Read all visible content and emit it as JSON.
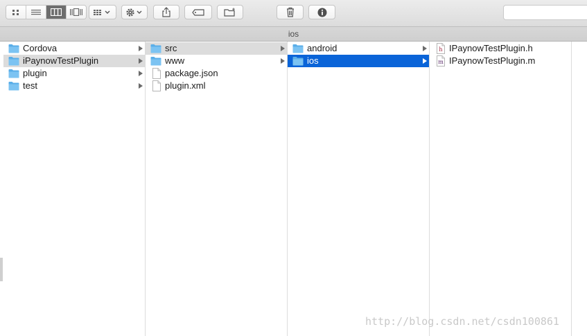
{
  "toolbar": {
    "view_modes": [
      "icon-view",
      "list-view",
      "column-view",
      "coverflow-view"
    ],
    "active_view": 2
  },
  "pathbar": {
    "title": "ios"
  },
  "columns": [
    {
      "items": [
        {
          "name": "Cordova",
          "type": "folder",
          "arrow": true,
          "selected": ""
        },
        {
          "name": "iPaynowTestPlugin",
          "type": "folder",
          "arrow": true,
          "selected": "gray"
        },
        {
          "name": "plugin",
          "type": "folder",
          "arrow": true,
          "selected": ""
        },
        {
          "name": "test",
          "type": "folder",
          "arrow": true,
          "selected": ""
        }
      ]
    },
    {
      "items": [
        {
          "name": "src",
          "type": "folder",
          "arrow": true,
          "selected": "gray"
        },
        {
          "name": "www",
          "type": "folder",
          "arrow": true,
          "selected": ""
        },
        {
          "name": "package.json",
          "type": "file",
          "arrow": false,
          "selected": ""
        },
        {
          "name": "plugin.xml",
          "type": "file",
          "arrow": false,
          "selected": ""
        }
      ]
    },
    {
      "items": [
        {
          "name": "android",
          "type": "folder",
          "arrow": true,
          "selected": ""
        },
        {
          "name": "ios",
          "type": "folder",
          "arrow": true,
          "selected": "blue"
        }
      ]
    },
    {
      "items": [
        {
          "name": "IPaynowTestPlugin.h",
          "type": "file-h",
          "arrow": false,
          "selected": "",
          "badge": "h"
        },
        {
          "name": "IPaynowTestPlugin.m",
          "type": "file-m",
          "arrow": false,
          "selected": "",
          "badge": "m"
        }
      ]
    }
  ],
  "watermark": "http://blog.csdn.net/csdn100861",
  "colors": {
    "selection_blue": "#0a64d8",
    "folder_blue": "#5fb3ec"
  }
}
